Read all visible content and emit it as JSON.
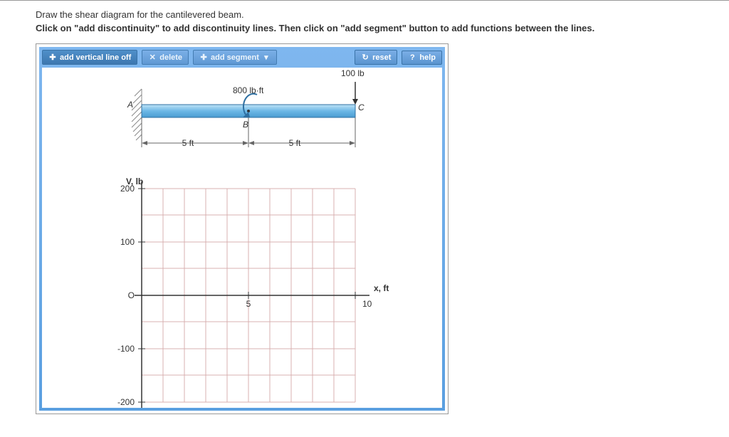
{
  "instructions": {
    "line1": "Draw the shear diagram for the cantilevered beam.",
    "line2": "Click on \"add discontinuity\" to add discontinuity lines. Then click on \"add segment\" button to add functions between the lines."
  },
  "toolbar": {
    "add_vertical_line_off": "add vertical line off",
    "delete": "delete",
    "add_segment": "add segment",
    "reset": "reset",
    "help": "help"
  },
  "icons": {
    "plus": "✚",
    "x": "✕",
    "refresh": "↻",
    "question": "?",
    "dropdown": "▾"
  },
  "beam": {
    "force_label": "100 lb",
    "moment_label": "800 lb·ft",
    "dim_left": "5 ft",
    "dim_right": "5 ft",
    "point_A": "A",
    "point_B": "B",
    "point_C": "C"
  },
  "chart_data": {
    "type": "line",
    "title": "",
    "ylabel": "V, lb",
    "xlabel": "x, ft",
    "xlim": [
      0,
      10
    ],
    "ylim": [
      -200,
      200
    ],
    "x_ticks": [
      0,
      5,
      10
    ],
    "x_tick_labels": [
      "O",
      "5",
      "10"
    ],
    "y_ticks": [
      -200,
      -100,
      0,
      100,
      200
    ],
    "y_tick_labels": [
      "-200",
      "-100",
      "O",
      "100",
      "200"
    ],
    "series": []
  }
}
